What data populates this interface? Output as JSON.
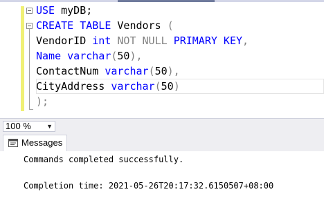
{
  "editor": {
    "lines": [
      [
        {
          "t": "USE",
          "c": "kw"
        },
        {
          "t": " myDB;",
          "c": ""
        }
      ],
      [
        {
          "t": "CREATE TABLE",
          "c": "kw"
        },
        {
          "t": " Vendors ",
          "c": ""
        },
        {
          "t": "(",
          "c": "gray"
        }
      ],
      [
        {
          "t": "VendorID ",
          "c": ""
        },
        {
          "t": "int",
          "c": "kw"
        },
        {
          "t": " NOT NULL ",
          "c": "gray"
        },
        {
          "t": "PRIMARY KEY",
          "c": "kw"
        },
        {
          "t": ",",
          "c": "gray"
        }
      ],
      [
        {
          "t": "Name ",
          "c": "kw"
        },
        {
          "t": "varchar",
          "c": "kw"
        },
        {
          "t": "(",
          "c": "gray"
        },
        {
          "t": "50",
          "c": ""
        },
        {
          "t": "),",
          "c": "gray"
        }
      ],
      [
        {
          "t": "ContactNum ",
          "c": ""
        },
        {
          "t": "varchar",
          "c": "kw"
        },
        {
          "t": "(",
          "c": "gray"
        },
        {
          "t": "50",
          "c": ""
        },
        {
          "t": "),",
          "c": "gray"
        }
      ],
      [
        {
          "t": "CityAddress ",
          "c": ""
        },
        {
          "t": "varchar",
          "c": "kw"
        },
        {
          "t": "(",
          "c": "gray"
        },
        {
          "t": "50",
          "c": ""
        },
        {
          "t": ")",
          "c": "gray"
        }
      ],
      [
        {
          "t": ");",
          "c": "gray"
        }
      ]
    ]
  },
  "zoom": {
    "value": "100 %"
  },
  "results": {
    "tab_label": "Messages",
    "messages": [
      "Commands completed successfully.",
      "",
      "Completion time: 2021-05-26T20:17:32.6150507+08:00"
    ]
  },
  "colors": {
    "keyword": "#0000ff",
    "punctuation": "#808080",
    "change_bar": "#f0f075"
  },
  "icons": {
    "messages_tab": "messages-icon",
    "fold": "collapse-icon",
    "zoom_dropdown": "chevron-down-icon"
  }
}
